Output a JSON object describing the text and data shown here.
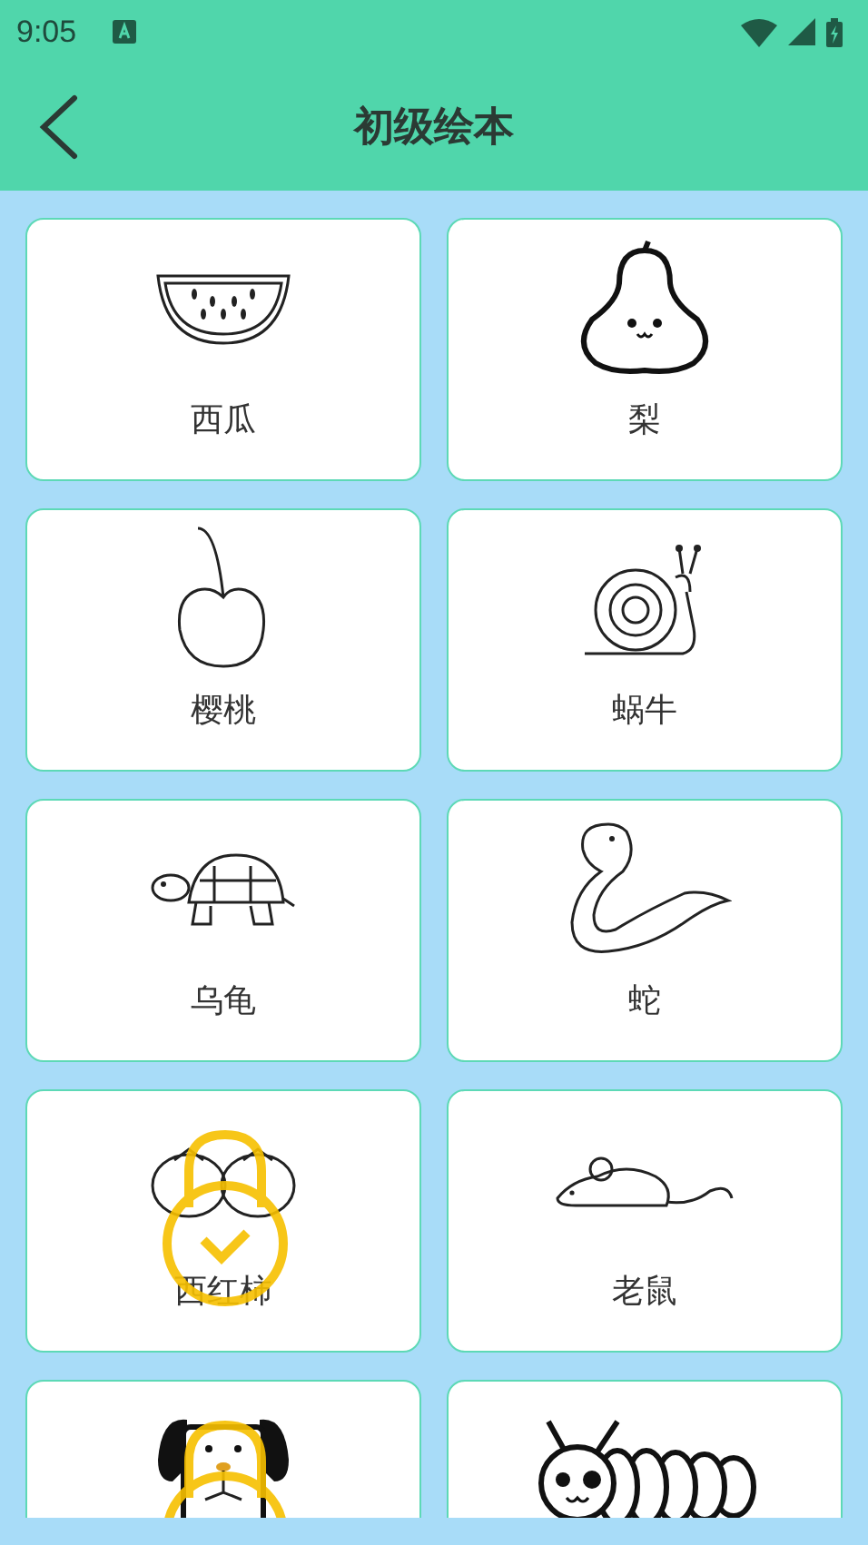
{
  "status_bar": {
    "time": "9:05"
  },
  "header": {
    "title": "初级绘本"
  },
  "items": [
    {
      "kind": "watermelon",
      "label": "西瓜",
      "locked": false
    },
    {
      "kind": "pear",
      "label": "梨",
      "locked": false
    },
    {
      "kind": "cherry",
      "label": "樱桃",
      "locked": false
    },
    {
      "kind": "snail",
      "label": "蜗牛",
      "locked": false
    },
    {
      "kind": "turtle",
      "label": "乌龟",
      "locked": false
    },
    {
      "kind": "snake",
      "label": "蛇",
      "locked": false
    },
    {
      "kind": "tomato",
      "label": "西红柿",
      "locked": true
    },
    {
      "kind": "mouse",
      "label": "老鼠",
      "locked": false
    },
    {
      "kind": "dog",
      "locked": true
    },
    {
      "kind": "caterpillar",
      "locked": false
    }
  ]
}
